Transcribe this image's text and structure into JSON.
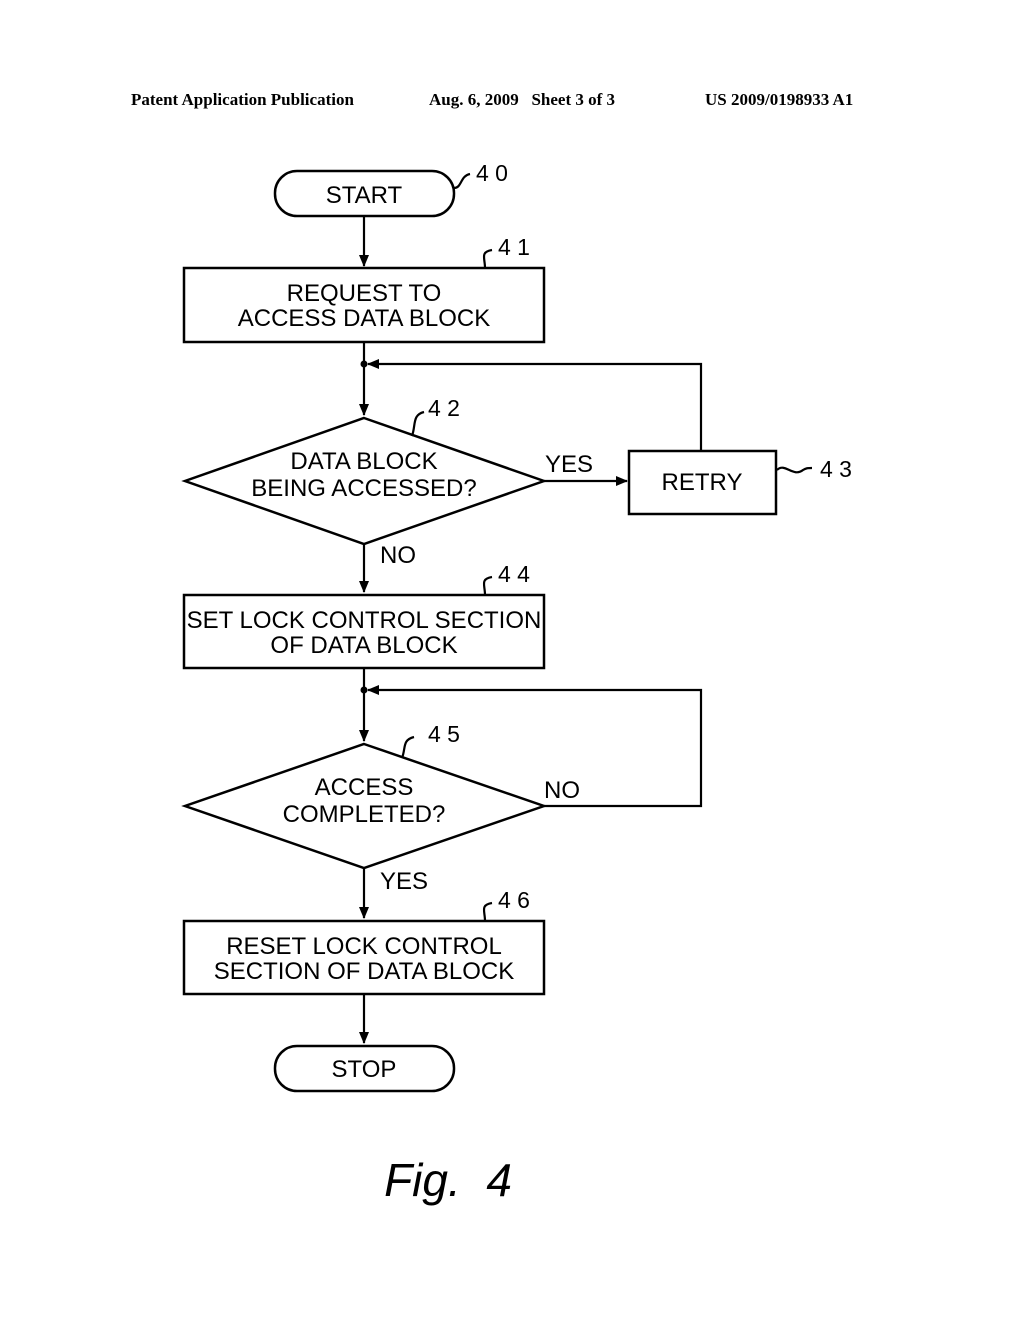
{
  "header": {
    "publication": "Patent Application Publication",
    "date_sheet": "Aug. 6, 2009   Sheet 3 of 3",
    "number": "US 2009/0198933 A1"
  },
  "flowchart": {
    "start": {
      "label": "START",
      "ref": "4 0"
    },
    "step41": {
      "line1": "REQUEST TO",
      "line2": "ACCESS DATA BLOCK",
      "ref": "4 1"
    },
    "decision42": {
      "line1": "DATA BLOCK",
      "line2": "BEING ACCESSED?",
      "ref": "4 2",
      "yes": "YES",
      "no": "NO"
    },
    "step43": {
      "label": "RETRY",
      "ref": "4 3"
    },
    "step44": {
      "line1": "SET LOCK CONTROL SECTION",
      "line2": "OF DATA BLOCK",
      "ref": "4 4"
    },
    "decision45": {
      "line1": "ACCESS",
      "line2": "COMPLETED?",
      "ref": "4 5",
      "yes": "YES",
      "no": "NO"
    },
    "step46": {
      "line1": "RESET LOCK CONTROL",
      "line2": "SECTION OF DATA BLOCK",
      "ref": "4 6"
    },
    "stop": {
      "label": "STOP"
    }
  },
  "figure_caption": "Fig.  4"
}
